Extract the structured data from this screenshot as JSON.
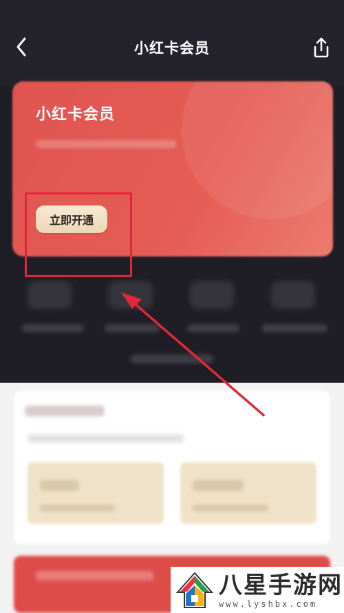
{
  "header": {
    "title": "小红卡会员"
  },
  "card": {
    "title": "小红卡会员",
    "open_button": "立即开通"
  },
  "watermark": {
    "name": "八星手游网",
    "url": "www.lyshbx.com"
  },
  "colors": {
    "background": "#1f1e26",
    "card": "#e0544f",
    "button": "#f0dfc2",
    "annotation": "#e02838",
    "panel": "#f3f2f2"
  },
  "icons": [
    "back-arrow-icon",
    "share-icon",
    "annotation-arrow"
  ]
}
